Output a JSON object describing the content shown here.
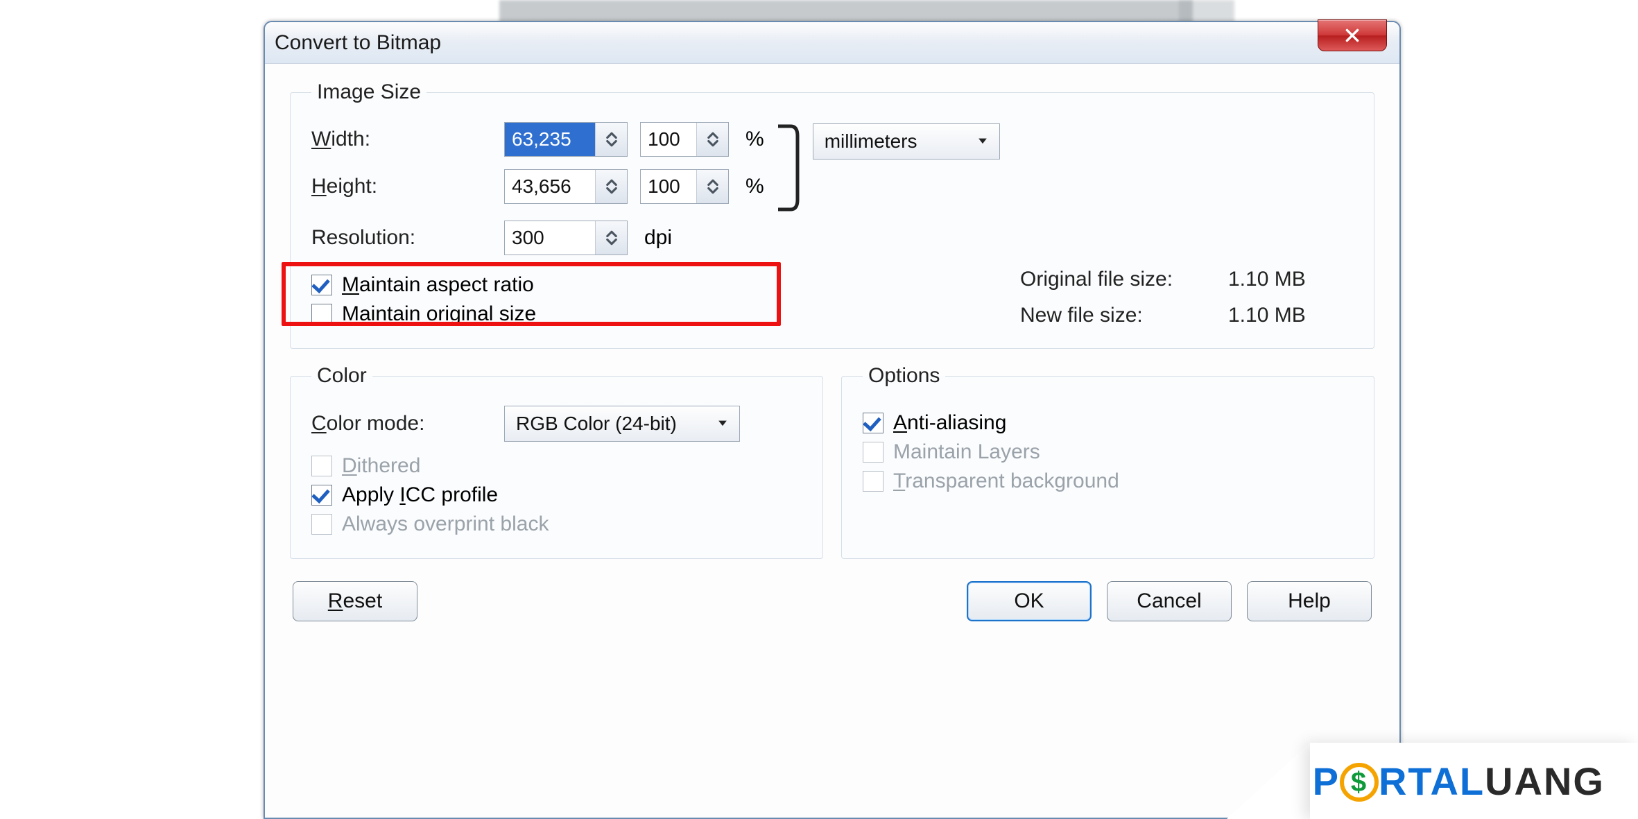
{
  "dialog": {
    "title": "Convert to Bitmap",
    "close_icon": "close-icon"
  },
  "image_size": {
    "legend": "Image Size",
    "width_label": "Width:",
    "width_value": "63,235",
    "width_pct": "100",
    "height_label": "Height:",
    "height_value": "43,656",
    "height_pct": "100",
    "pct_symbol": "%",
    "resolution_label": "Resolution:",
    "resolution_value": "300",
    "resolution_unit": "dpi",
    "units_selected": "millimeters",
    "maintain_aspect_label": "Maintain aspect ratio",
    "maintain_original_label": "Maintain original size",
    "original_size_label": "Original file size:",
    "original_size_value": "1.10 MB",
    "new_size_label": "New file size:",
    "new_size_value": "1.10 MB"
  },
  "color": {
    "legend": "Color",
    "mode_label": "Color mode:",
    "mode_selected": "RGB Color (24-bit)",
    "dithered_label": "Dithered",
    "apply_icc_label": "Apply ICC profile",
    "overprint_label": "Always overprint black"
  },
  "options": {
    "legend": "Options",
    "anti_alias_label": "Anti-aliasing",
    "maintain_layers_label": "Maintain Layers",
    "transparent_bg_label": "Transparent background"
  },
  "buttons": {
    "reset": "Reset",
    "ok": "OK",
    "cancel": "Cancel",
    "help": "Help"
  },
  "watermark": {
    "p": "P",
    "dollar": "$",
    "rtal": "RTAL",
    "uang": "UANG"
  }
}
